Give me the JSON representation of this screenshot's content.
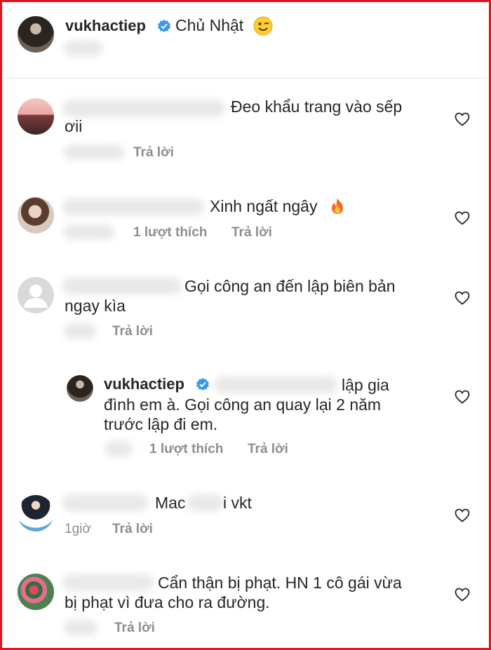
{
  "post": {
    "username": "vukhactiep",
    "caption": "Chủ Nhật",
    "caption_emoji": "winking-face"
  },
  "comments": [
    {
      "line1": "Đeo khẩu trang vào sếp",
      "line2": "ơii",
      "reply": "Trả lời"
    },
    {
      "line1": "Xinh ngất ngây",
      "emoji": "fire",
      "likes": "1 lượt thích",
      "reply": "Trả lời"
    },
    {
      "line1": "Gọi công an đến lập biên bản",
      "line2": "ngay kìa",
      "reply": "Trả lời",
      "replies": [
        {
          "username": "vukhactiep",
          "line1": "lập gia",
          "line2": "đình em à. Gọi công an quay lại 2 năm",
          "line3": "trước lập đi em.",
          "likes": "1 lượt thích",
          "reply": "Trả lời"
        }
      ]
    },
    {
      "part1": "Mac",
      "part2": "i vkt",
      "time": "1giờ",
      "reply": "Trả lời"
    },
    {
      "line1": "Cẩn thận bị phạt. HN 1 cô gái vừa",
      "line2": "bị phạt vì đưa cho ra đường.",
      "reply": "Trả lời"
    }
  ],
  "colors": {
    "frame": "#e0141e",
    "text": "#262626",
    "meta": "#8e8e8e",
    "verified": "#3897f0"
  }
}
